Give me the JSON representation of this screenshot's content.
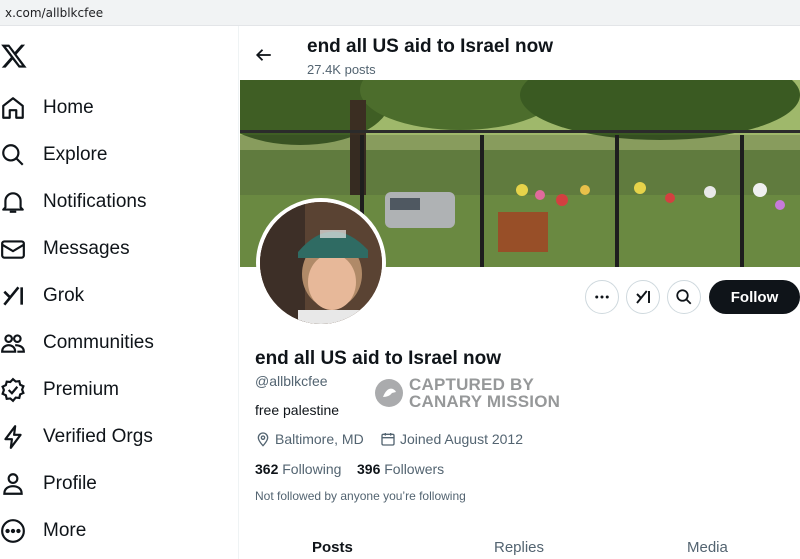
{
  "browser": {
    "url": "x.com/allblkcfee"
  },
  "sidebar": {
    "logo": "x-logo-icon",
    "items": [
      {
        "label": "Home",
        "icon": "home-icon"
      },
      {
        "label": "Explore",
        "icon": "search-icon"
      },
      {
        "label": "Notifications",
        "icon": "bell-icon"
      },
      {
        "label": "Messages",
        "icon": "envelope-icon"
      },
      {
        "label": "Grok",
        "icon": "grok-icon"
      },
      {
        "label": "Communities",
        "icon": "people-icon"
      },
      {
        "label": "Premium",
        "icon": "premium-icon"
      },
      {
        "label": "Verified Orgs",
        "icon": "lightning-icon"
      },
      {
        "label": "Profile",
        "icon": "person-icon"
      },
      {
        "label": "More",
        "icon": "more-circle-icon"
      }
    ]
  },
  "header": {
    "name": "end all US aid to Israel now",
    "posts": "27.4K posts"
  },
  "profile": {
    "name": "end all US aid to Israel now",
    "handle": "@allblkcfee",
    "bio": "free palestine",
    "location": "Baltimore, MD",
    "joined": "Joined August 2012",
    "following_count": "362",
    "following_label": "Following",
    "followers_count": "396",
    "followers_label": "Followers",
    "not_followed": "Not followed by anyone you’re following",
    "follow_label": "Follow"
  },
  "watermark": {
    "line1": "CAPTURED BY",
    "line2": "CANARY MISSION"
  },
  "tabs": [
    "Posts",
    "Replies",
    "Media"
  ],
  "colors": {
    "text": "#0f1419",
    "muted": "#536471",
    "border": "#cfd9de",
    "follow_bg": "#0f1419"
  }
}
